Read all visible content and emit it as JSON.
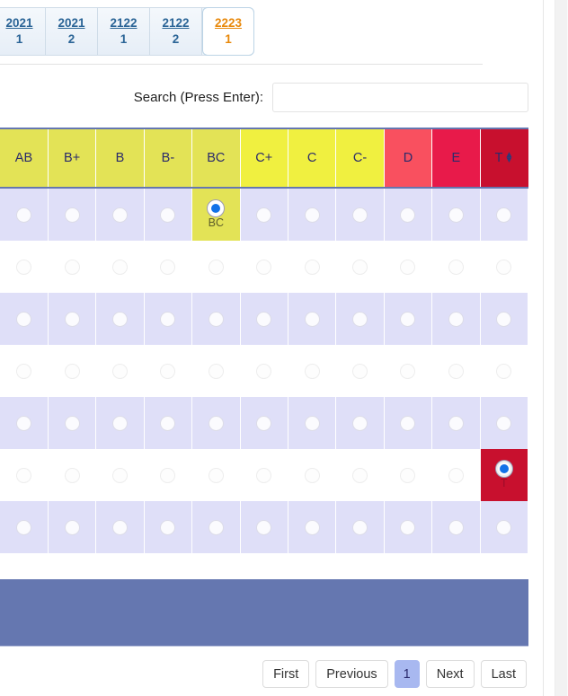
{
  "tabs": [
    {
      "year": "2021",
      "semester": "1",
      "active": false
    },
    {
      "year": "2021",
      "semester": "2",
      "active": false
    },
    {
      "year": "2122",
      "semester": "1",
      "active": false
    },
    {
      "year": "2122",
      "semester": "2",
      "active": false
    },
    {
      "year": "2223",
      "semester": "1",
      "active": true
    }
  ],
  "search": {
    "label": "Search (Press Enter):",
    "value": "",
    "placeholder": ""
  },
  "table": {
    "columns": [
      {
        "label": "AB",
        "color": "#e3e356",
        "sortable": false
      },
      {
        "label": "B+",
        "color": "#e3e356",
        "sortable": false
      },
      {
        "label": "B",
        "color": "#e3e356",
        "sortable": false
      },
      {
        "label": "B-",
        "color": "#e3e356",
        "sortable": false
      },
      {
        "label": "BC",
        "color": "#e3e356",
        "sortable": false
      },
      {
        "label": "C+",
        "color": "#f0f040",
        "sortable": false
      },
      {
        "label": "C",
        "color": "#f0f040",
        "sortable": false
      },
      {
        "label": "C-",
        "color": "#f0f040",
        "sortable": false
      },
      {
        "label": "D",
        "color": "#f9505f",
        "sortable": false
      },
      {
        "label": "E",
        "color": "#e81a4a",
        "sortable": false
      },
      {
        "label": "T",
        "color": "#c8102e",
        "sortable": true
      }
    ],
    "sort_icon": "sort-updown-icon",
    "rows": [
      {
        "stripe": "odd",
        "selected_index": 4,
        "selected_label": "BC"
      },
      {
        "stripe": "even",
        "selected_index": -1,
        "selected_label": ""
      },
      {
        "stripe": "odd",
        "selected_index": -1,
        "selected_label": ""
      },
      {
        "stripe": "even",
        "selected_index": -1,
        "selected_label": ""
      },
      {
        "stripe": "odd",
        "selected_index": -1,
        "selected_label": ""
      },
      {
        "stripe": "even",
        "selected_index": 10,
        "selected_label": "T"
      },
      {
        "stripe": "odd",
        "selected_index": -1,
        "selected_label": ""
      }
    ]
  },
  "pagination": {
    "first": "First",
    "previous": "Previous",
    "current_page": "1",
    "next": "Next",
    "last": "Last"
  },
  "colors": {
    "header_blue": "#6577b0",
    "row_stripe": "#dfdff8",
    "active_tab_text": "#e8880a",
    "tab_link": "#2a6496",
    "radio_dot": "#1272e8",
    "pager_active": "#a8b8f0"
  }
}
